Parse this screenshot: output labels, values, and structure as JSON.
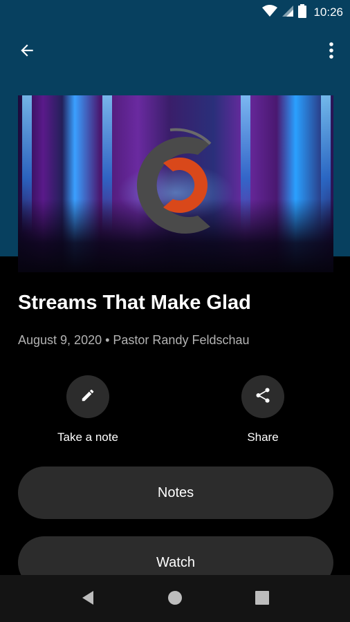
{
  "status_bar": {
    "time": "10:26",
    "icons": [
      "wifi-icon",
      "signal-icon",
      "battery-icon"
    ]
  },
  "toolbar": {
    "back_icon": "arrow-back-icon",
    "menu_icon": "more-vert-icon"
  },
  "sermon": {
    "title": "Streams That Make Glad",
    "subtitle": "August 9, 2020 • Pastor Randy Feldschau"
  },
  "actions": [
    {
      "label": "Take a note",
      "icon": "pencil-icon"
    },
    {
      "label": "Share",
      "icon": "share-icon"
    }
  ],
  "buttons": {
    "notes": "Notes",
    "watch": "Watch"
  },
  "nav": {
    "icons": [
      "nav-back-icon",
      "nav-home-icon",
      "nav-recents-icon"
    ]
  },
  "colors": {
    "header": "#07405f",
    "background": "#000000",
    "pill": "#2c2c2c",
    "logo_orange": "#d9481a",
    "logo_gray": "#4a4a4a"
  }
}
